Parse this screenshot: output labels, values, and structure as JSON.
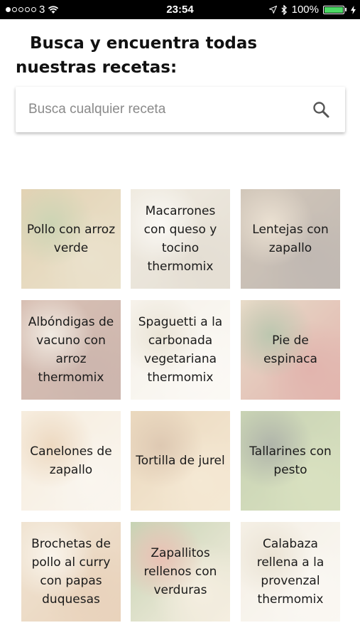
{
  "status_bar": {
    "carrier": "3",
    "time": "23:54",
    "battery_percent": "100%",
    "battery_level": 1.0
  },
  "heading": "Busca y encuentra todas nuestras recetas:",
  "search": {
    "placeholder": "Busca cualquier receta",
    "icon": "search-icon"
  },
  "recipes": [
    {
      "label": "Pollo con arroz verde",
      "colors": [
        "#b58a3a",
        "#7a8f3b",
        "#c9b27a"
      ]
    },
    {
      "label": "Macarrones con queso y tocino thermomix",
      "colors": [
        "#d8cbb0",
        "#f3efe6",
        "#b9a98d"
      ]
    },
    {
      "label": "Lentejas con zapallo",
      "colors": [
        "#8a6d4a",
        "#cbb08a",
        "#5b4636"
      ]
    },
    {
      "label": "Albóndigas de vacuno con arroz thermomix",
      "colors": [
        "#9a5a3a",
        "#d9c8b2",
        "#7b3f2a"
      ]
    },
    {
      "label": "Spaguetti a la carbonada vegetariana thermomix",
      "colors": [
        "#e7dcc8",
        "#c9b894",
        "#f4efe4"
      ]
    },
    {
      "label": "Pie de espinaca",
      "colors": [
        "#c2a271",
        "#4f6b2e",
        "#b23b2a"
      ]
    },
    {
      "label": "Canelones de zapallo",
      "colors": [
        "#e8cfa8",
        "#cf9a5b",
        "#f1e6d4"
      ]
    },
    {
      "label": "Tortilla de jurel",
      "colors": [
        "#c99a55",
        "#a87036",
        "#e4c48e"
      ]
    },
    {
      "label": "Tallarines con pesto",
      "colors": [
        "#6f8a3a",
        "#2f3b20",
        "#9bb05a"
      ]
    },
    {
      "label": "Brochetas de pollo al curry con papas duquesas",
      "colors": [
        "#d9b98a",
        "#efe2cc",
        "#c48a4e"
      ]
    },
    {
      "label": "Zapallitos rellenos con verduras",
      "colors": [
        "#6b8c3a",
        "#c95a3a",
        "#e6d3b0"
      ]
    },
    {
      "label": "Calabaza rellena a la provenzal thermomix",
      "colors": [
        "#e4d6bb",
        "#c8b48d",
        "#f2ece0"
      ]
    }
  ]
}
